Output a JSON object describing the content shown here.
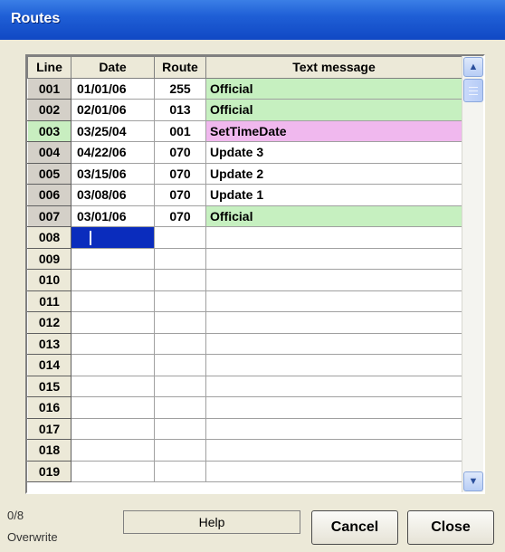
{
  "window": {
    "title": "Routes"
  },
  "grid": {
    "headers": {
      "line": "Line",
      "date": "Date",
      "route": "Route",
      "message": "Text message"
    },
    "rows": [
      {
        "line": "001",
        "date": "01/01/06",
        "route": "255",
        "message": "Official",
        "style": "official"
      },
      {
        "line": "002",
        "date": "02/01/06",
        "route": "013",
        "message": "Official",
        "style": "official"
      },
      {
        "line": "003",
        "date": "03/25/04",
        "route": "001",
        "message": "SetTimeDate",
        "style": "settime"
      },
      {
        "line": "004",
        "date": "04/22/06",
        "route": "070",
        "message": "Update 3",
        "style": "plain"
      },
      {
        "line": "005",
        "date": "03/15/06",
        "route": "070",
        "message": "Update 2",
        "style": "plain"
      },
      {
        "line": "006",
        "date": "03/08/06",
        "route": "070",
        "message": "Update 1",
        "style": "plain"
      },
      {
        "line": "007",
        "date": "03/01/06",
        "route": "070",
        "message": "Official",
        "style": "official"
      },
      {
        "line": "008",
        "date": "",
        "route": "",
        "message": "",
        "style": "editing"
      },
      {
        "line": "009",
        "date": "",
        "route": "",
        "message": "",
        "style": "empty"
      },
      {
        "line": "010",
        "date": "",
        "route": "",
        "message": "",
        "style": "empty"
      },
      {
        "line": "011",
        "date": "",
        "route": "",
        "message": "",
        "style": "empty"
      },
      {
        "line": "012",
        "date": "",
        "route": "",
        "message": "",
        "style": "empty"
      },
      {
        "line": "013",
        "date": "",
        "route": "",
        "message": "",
        "style": "empty"
      },
      {
        "line": "014",
        "date": "",
        "route": "",
        "message": "",
        "style": "empty"
      },
      {
        "line": "015",
        "date": "",
        "route": "",
        "message": "",
        "style": "empty"
      },
      {
        "line": "016",
        "date": "",
        "route": "",
        "message": "",
        "style": "empty"
      },
      {
        "line": "017",
        "date": "",
        "route": "",
        "message": "",
        "style": "empty"
      },
      {
        "line": "018",
        "date": "",
        "route": "",
        "message": "",
        "style": "empty"
      },
      {
        "line": "019",
        "date": "",
        "route": "",
        "message": "",
        "style": "empty"
      }
    ],
    "colors": {
      "official": "#c6f0c0",
      "settime": "#f0b8ee",
      "selected": "#0a2cbd"
    },
    "icons": {
      "scroll_up": "arrow-up-icon",
      "scroll_down": "arrow-down-icon"
    }
  },
  "status": {
    "counter": "0/8",
    "mode": "Overwrite"
  },
  "buttons": {
    "help": "Help",
    "cancel": "Cancel",
    "close": "Close"
  }
}
